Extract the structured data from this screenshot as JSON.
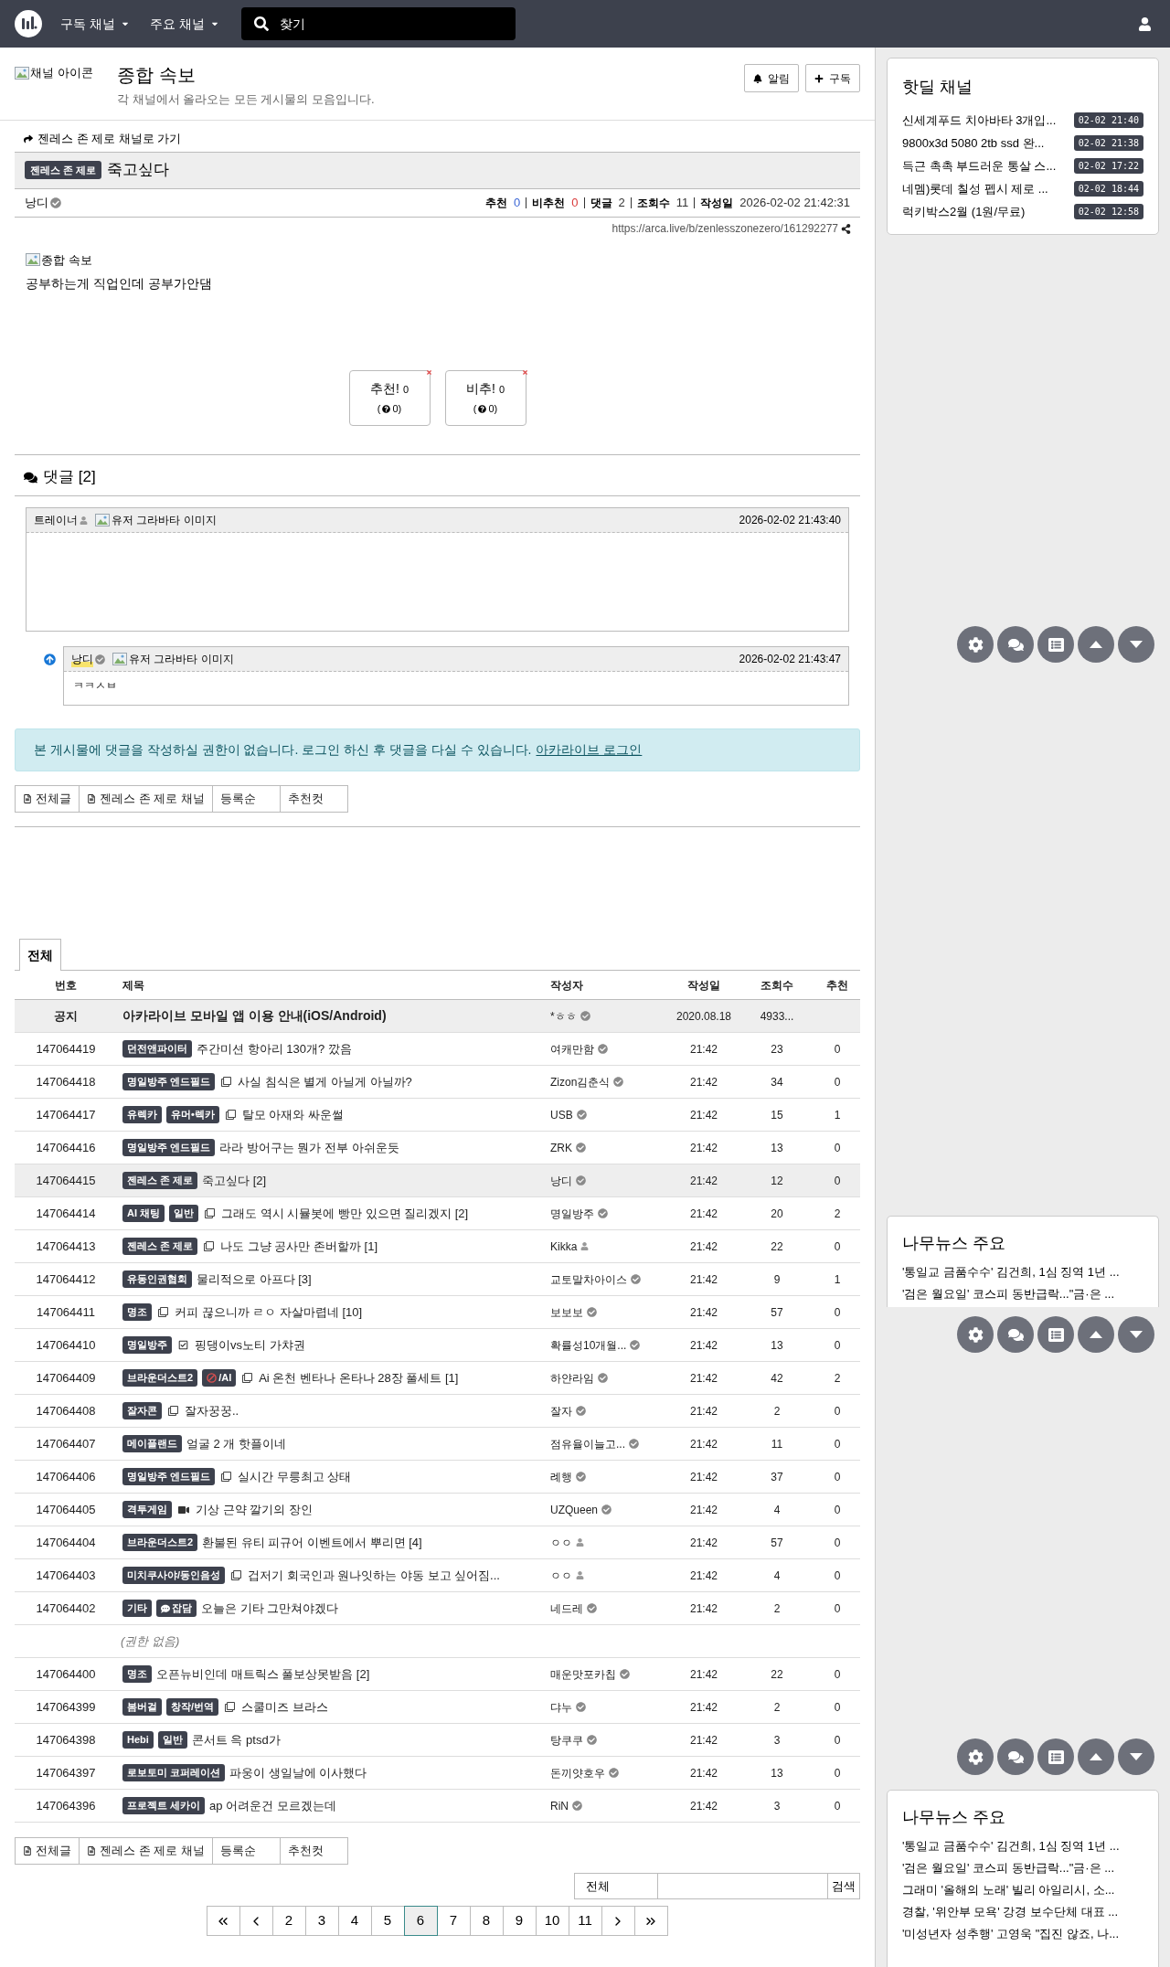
{
  "navbar": {
    "menus": [
      "구독 채널",
      "주요 채널"
    ],
    "search": {
      "placeholder": "찾기"
    }
  },
  "channel": {
    "icon_alt": "채널 아이콘",
    "title": "종합 속보",
    "description": "각 채널에서 올라오는 모든 게시물의 모음입니다.",
    "buttons": [
      "알림",
      "구독"
    ]
  },
  "post": {
    "back_link": "젠레스 존 제로 채널로 가기",
    "category": "젠레스 존 제로",
    "title": "죽고싶다",
    "author": "낭디",
    "verified": true,
    "stats": [
      {
        "label": "추천",
        "value": "0",
        "color": "#3b66d6"
      },
      {
        "label": "비추천",
        "value": "0",
        "color": "#d93a3a"
      },
      {
        "label": "댓글",
        "value": "2"
      },
      {
        "label": "조회수",
        "value": "11"
      },
      {
        "label": "작성일",
        "value": "2026-02-02 21:42:31"
      }
    ],
    "url": "https://arca.live/b/zenlesszonezero/161292277",
    "image_alt": "종합 속보",
    "body": "공부하는게 직업인데 공부가안댐",
    "votes": [
      {
        "label": "추천!",
        "count": "0",
        "sub_open": "(",
        "sub_close": "0)"
      },
      {
        "label": "비추!",
        "count": "0",
        "sub_open": "(",
        "sub_close": "0)"
      }
    ]
  },
  "comments": {
    "title": "댓글 [2]",
    "items": [
      {
        "author": "트레이너",
        "verified": false,
        "highlighted": false,
        "avatar_alt": "유저 그라바타 이미지",
        "time": "2026-02-02 21:43:40",
        "children": [
          {
            "author": "낭디",
            "verified": true,
            "highlighted": true,
            "avatar_alt": "유저 그라바타 이미지",
            "time": "2026-02-02 21:43:47",
            "body": "ㅋㅋㅅㅂ"
          }
        ]
      }
    ]
  },
  "login_notice": {
    "text": "본 게시물에 댓글을 작성하실 권한이 없습니다. 로그인 하신 후 댓글을 다실 수 있습니다.",
    "link": "아카라이브 로그인"
  },
  "filter_bar_top": [
    {
      "label": "전체글",
      "icon": true
    },
    {
      "label": "젠레스 존 제로 채널",
      "icon": true
    },
    {
      "label": "등록순",
      "icon": false
    },
    {
      "label": "추천컷",
      "icon": false
    }
  ],
  "board_tabs": [
    {
      "label": "전체",
      "selected": true
    }
  ],
  "table": {
    "columns": [
      "번호",
      "제목",
      "작성자",
      "작성일",
      "조회수",
      "추천"
    ],
    "rows": [
      {
        "kind": "notice",
        "number": "공지",
        "title": "아카라이브 모바일 앱 이용 안내(iOS/Android)",
        "author": "*ㅎㅎ",
        "verified": true,
        "date": "2020.08.18",
        "views": "4933..."
      },
      {
        "kind": "post",
        "number": "147064419",
        "tags": [
          {
            "label": "던전앤파이터"
          }
        ],
        "title": "주간미션 항아리 130개? 깠음",
        "author": "여캐만함",
        "verified": true,
        "date": "21:42",
        "views": "23",
        "votes": "0",
        "selected": false
      },
      {
        "kind": "post",
        "number": "147064418",
        "tags": [
          {
            "label": "명일방주 엔드필드"
          }
        ],
        "attachment": {
          "kind": "image"
        },
        "title": "사실 침식은 별게 아닐게 아닐까?",
        "author": "Zizon김춘식",
        "verified": true,
        "date": "21:42",
        "views": "34",
        "votes": "0",
        "selected": false
      },
      {
        "kind": "post",
        "number": "147064417",
        "tags": [
          {
            "label": "유렉카"
          },
          {
            "label": "유머•렉카"
          }
        ],
        "attachment": {
          "kind": "image"
        },
        "title": "탈모 아재와 싸운썰",
        "author": "USB",
        "verified": true,
        "date": "21:42",
        "views": "15",
        "votes": "1",
        "selected": false
      },
      {
        "kind": "post",
        "number": "147064416",
        "tags": [
          {
            "label": "명일방주 엔드필드"
          }
        ],
        "title": "라라 방어구는 뭔가 전부 아쉬운듯",
        "author": "ZRK",
        "verified": true,
        "date": "21:42",
        "views": "13",
        "votes": "0",
        "selected": false
      },
      {
        "kind": "post",
        "number": "147064415",
        "tags": [
          {
            "label": "젠레스 존 제로"
          }
        ],
        "title": "죽고싶다 [2]",
        "author": "낭디",
        "verified": true,
        "date": "21:42",
        "views": "12",
        "votes": "0",
        "selected": true
      },
      {
        "kind": "post",
        "number": "147064414",
        "tags": [
          {
            "label": "AI 채팅"
          },
          {
            "label": "일반"
          }
        ],
        "attachment": {
          "kind": "image"
        },
        "title": "그래도 역시 시뮬봇에 빵만 있으면 질리겠지 [2]",
        "author": "명일방주",
        "verified": true,
        "date": "21:42",
        "views": "20",
        "votes": "2",
        "selected": false
      },
      {
        "kind": "post",
        "number": "147064413",
        "tags": [
          {
            "label": "젠레스 존 제로"
          }
        ],
        "attachment": {
          "kind": "image"
        },
        "title": "나도 그냥 공사만 존버할까 [1]",
        "author": "Kikka",
        "verified": false,
        "date": "21:42",
        "views": "22",
        "votes": "0",
        "selected": false
      },
      {
        "kind": "post",
        "number": "147064412",
        "tags": [
          {
            "label": "유동인권협회"
          }
        ],
        "title": "물리적으로 아프다 [3]",
        "author": "교토말차아이스",
        "verified": true,
        "date": "21:42",
        "views": "9",
        "votes": "1",
        "selected": false
      },
      {
        "kind": "post",
        "number": "147064411",
        "tags": [
          {
            "label": "명조"
          }
        ],
        "attachment": {
          "kind": "image"
        },
        "title": "커피 끊으니까 ㄹㅇ 자살마렵네 [10]",
        "author": "보보보",
        "verified": true,
        "date": "21:42",
        "views": "57",
        "votes": "0",
        "selected": false
      },
      {
        "kind": "post",
        "number": "147064410",
        "tags": [
          {
            "label": "명일방주"
          }
        ],
        "attachment": {
          "kind": "poll"
        },
        "title": "핑댕이vs노티 가챠권",
        "author": "확률성10개월...",
        "verified": true,
        "date": "21:42",
        "views": "13",
        "votes": "0",
        "selected": false
      },
      {
        "kind": "post",
        "number": "147064409",
        "tags": [
          {
            "label": "브라운더스트2"
          },
          {
            "label": "/AI",
            "kind": "adult"
          }
        ],
        "attachment": {
          "kind": "image"
        },
        "title": "Ai 온천 벤타나 온타나 28장 풀세트 [1]",
        "author": "하얀라임",
        "verified": true,
        "date": "21:42",
        "views": "42",
        "votes": "2",
        "selected": false
      },
      {
        "kind": "post",
        "number": "147064408",
        "tags": [
          {
            "label": "잘자콘"
          }
        ],
        "attachment": {
          "kind": "image"
        },
        "title": "잘자꿍꿍..",
        "author": "잘자",
        "verified": true,
        "date": "21:42",
        "views": "2",
        "votes": "0",
        "selected": false
      },
      {
        "kind": "post",
        "number": "147064407",
        "tags": [
          {
            "label": "메이플랜드"
          }
        ],
        "title": "얼굴 2 개 핫플이네",
        "author": "점유율이늘고...",
        "verified": true,
        "date": "21:42",
        "views": "11",
        "votes": "0",
        "selected": false
      },
      {
        "kind": "post",
        "number": "147064406",
        "tags": [
          {
            "label": "명일방주 엔드필드"
          }
        ],
        "attachment": {
          "kind": "image"
        },
        "title": "실시간 무릉최고 상태",
        "author": "례행",
        "verified": true,
        "date": "21:42",
        "views": "37",
        "votes": "0",
        "selected": false
      },
      {
        "kind": "post",
        "number": "147064405",
        "tags": [
          {
            "label": "격투게임"
          }
        ],
        "attachment": {
          "kind": "video"
        },
        "title": "기상 근약 깔기의 장인",
        "author": "UZQueen",
        "verified": true,
        "date": "21:42",
        "views": "4",
        "votes": "0",
        "selected": false
      },
      {
        "kind": "post",
        "number": "147064404",
        "tags": [
          {
            "label": "브라운더스트2"
          }
        ],
        "title": "환불된 유티 피규어 이벤트에서 뿌리면 [4]",
        "author": "ㅇㅇ",
        "verified": false,
        "date": "21:42",
        "views": "57",
        "votes": "0",
        "selected": false
      },
      {
        "kind": "post",
        "number": "147064403",
        "tags": [
          {
            "label": "미치쿠사야/동인음성"
          }
        ],
        "attachment": {
          "kind": "image"
        },
        "title": "겁저기 회국인과 원나잇하는 야동 보고 싶어짐...",
        "author": "ㅇㅇ",
        "verified": false,
        "date": "21:42",
        "views": "4",
        "votes": "0",
        "selected": false
      },
      {
        "kind": "post",
        "number": "147064402",
        "tags": [
          {
            "label": "기타"
          },
          {
            "label": "잡담",
            "kind": "chat"
          }
        ],
        "title": "오늘은 기타 그만쳐야겠다",
        "author": "네드레",
        "verified": true,
        "date": "21:42",
        "views": "2",
        "votes": "0",
        "selected": false
      },
      {
        "kind": "restricted",
        "title": "(권한 없음)",
        "selected": false
      },
      {
        "kind": "post",
        "number": "147064400",
        "tags": [
          {
            "label": "명조"
          }
        ],
        "title": "오픈뉴비인데 매트릭스 풀보상못받음 [2]",
        "author": "매운맛포카칩",
        "verified": true,
        "date": "21:42",
        "views": "22",
        "votes": "0",
        "selected": false
      },
      {
        "kind": "post",
        "number": "147064399",
        "tags": [
          {
            "label": "봄버걸"
          },
          {
            "label": "창작/번역"
          }
        ],
        "attachment": {
          "kind": "image"
        },
        "title": "스쿨미즈 브라스",
        "author": "댜누",
        "verified": true,
        "date": "21:42",
        "views": "2",
        "votes": "0",
        "selected": false
      },
      {
        "kind": "post",
        "number": "147064398",
        "tags": [
          {
            "label": "Hebi"
          },
          {
            "label": "일반"
          }
        ],
        "title": "콘서트 윽 ptsd가",
        "author": "탕쿠쿠",
        "verified": true,
        "date": "21:42",
        "views": "3",
        "votes": "0",
        "selected": false
      },
      {
        "kind": "post",
        "number": "147064397",
        "tags": [
          {
            "label": "로보토미 코퍼레이션"
          }
        ],
        "title": "파웅이 생일날에 이사했다",
        "author": "돈끼얏호우",
        "verified": true,
        "date": "21:42",
        "views": "13",
        "votes": "0",
        "selected": false
      },
      {
        "kind": "post",
        "number": "147064396",
        "tags": [
          {
            "label": "프로젝트 세카이"
          }
        ],
        "title": "ap 어려운건 모르겠는데",
        "author": "RiN",
        "verified": true,
        "date": "21:42",
        "views": "3",
        "votes": "0",
        "selected": false
      }
    ]
  },
  "filter_bar_bottom": [
    {
      "label": "전체글",
      "icon": true
    },
    {
      "label": "젠레스 존 제로 채널",
      "icon": true
    },
    {
      "label": "등록순",
      "icon": false
    },
    {
      "label": "추천컷",
      "icon": false
    }
  ],
  "board_search": {
    "scope": "전체",
    "button": "검색"
  },
  "pagination": [
    {
      "kind": "first",
      "selected": false
    },
    {
      "kind": "prev",
      "selected": false
    },
    {
      "kind": "page",
      "label": "2",
      "selected": false
    },
    {
      "kind": "page",
      "label": "3",
      "selected": false
    },
    {
      "kind": "page",
      "label": "4",
      "selected": false
    },
    {
      "kind": "page",
      "label": "5",
      "selected": false
    },
    {
      "kind": "page",
      "label": "6",
      "selected": true
    },
    {
      "kind": "page",
      "label": "7",
      "selected": false
    },
    {
      "kind": "page",
      "label": "8",
      "selected": false
    },
    {
      "kind": "page",
      "label": "9",
      "selected": false
    },
    {
      "kind": "page",
      "label": "10",
      "selected": false
    },
    {
      "kind": "page",
      "label": "11",
      "selected": false
    },
    {
      "kind": "next",
      "selected": false
    },
    {
      "kind": "last",
      "selected": false
    }
  ],
  "sidebar": {
    "hotdeal": {
      "title": "핫딜 채널",
      "items": [
        {
          "title": "신세계푸드 치아바타 3개입...",
          "time": "02-02 21:40"
        },
        {
          "title": "9800x3d 5080 2tb ssd 완...",
          "time": "02-02 21:38"
        },
        {
          "title": "득근 촉촉 부드러운 통살 스...",
          "time": "02-02 17:22"
        },
        {
          "title": "네멤)롯데 칠성 펩시 제로 ...",
          "time": "02-02 18:44"
        },
        {
          "title": "럭키박스2월 (1원/무료)",
          "time": "02-02 12:58"
        }
      ]
    },
    "news_cards": [
      {
        "title": "나무뉴스 주요",
        "items": [
          "'통일교 금품수수' 김건희, 1심 징역 1년 ...",
          "'검은 월요일' 코스피 동반급락...\"금·은 ..."
        ]
      },
      {
        "title": "나무뉴스 주요",
        "items": [
          "'통일교 금품수수' 김건희, 1심 징역 1년 ...",
          "'검은 월요일' 코스피 동반급락...\"금·은 ...",
          "그래미 '올해의 노래' 빌리 아일리시, 소...",
          "경찰, '위안부 모욕' 강경 보수단체 대표 ...",
          "'미성년자 성추행' 고영욱 \"집진 않죠, 나..."
        ]
      }
    ]
  }
}
